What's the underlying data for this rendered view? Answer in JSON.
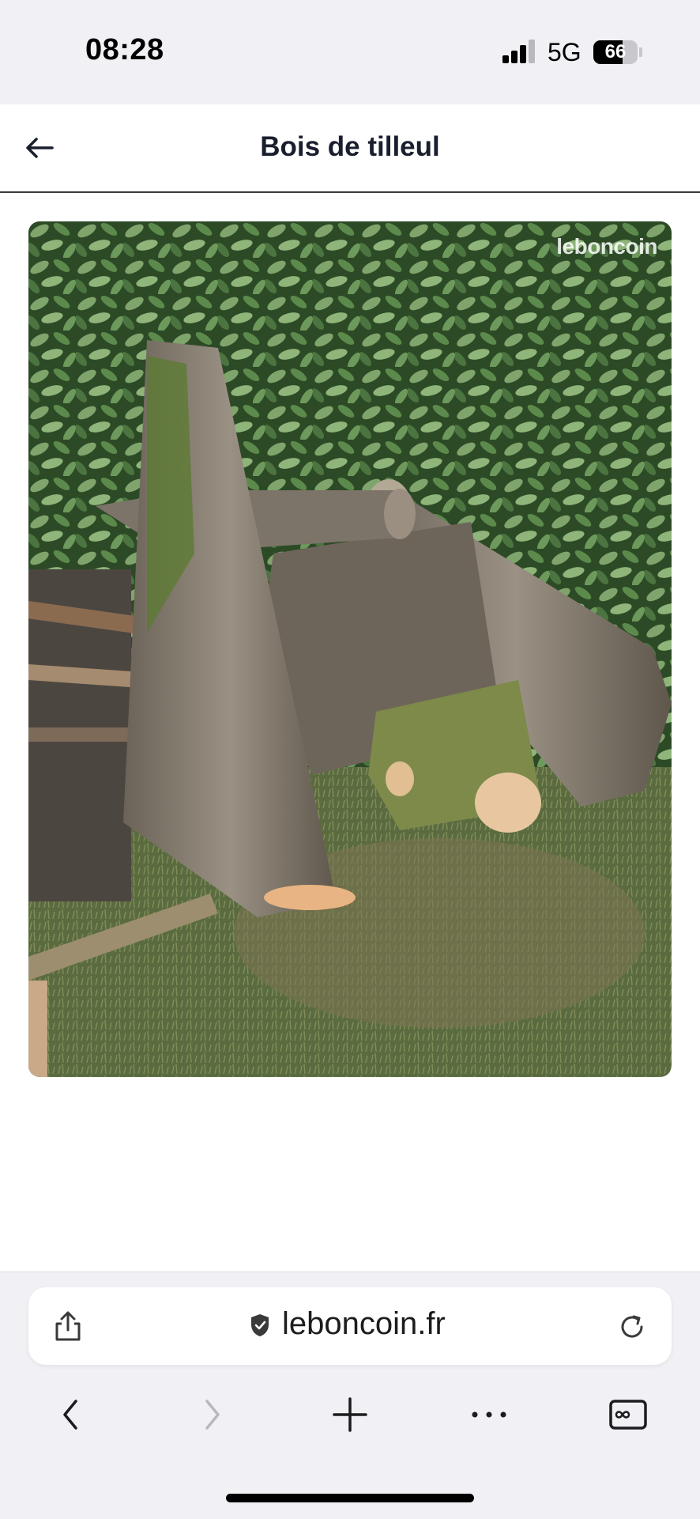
{
  "status_bar": {
    "time": "08:28",
    "network": "5G",
    "battery_pct": "66",
    "battery_level": 0.66,
    "signal_bars": 3
  },
  "header": {
    "title": "Bois de tilleul",
    "back_icon": "arrow-left-icon"
  },
  "photo": {
    "watermark": "leboncoin"
  },
  "browser": {
    "url": "leboncoin.fr",
    "icons": {
      "share": "share-icon",
      "secure": "shield-check-icon",
      "reload": "reload-icon",
      "back": "chevron-left-icon",
      "forward": "chevron-right-icon",
      "new_tab": "plus-icon",
      "more": "more-icon",
      "tabs": "tabs-icon"
    },
    "forward_enabled": false
  },
  "colors": {
    "title": "#1a1f2e",
    "chrome_bg": "#f0f0f5",
    "disabled": "#b9b9bd"
  }
}
